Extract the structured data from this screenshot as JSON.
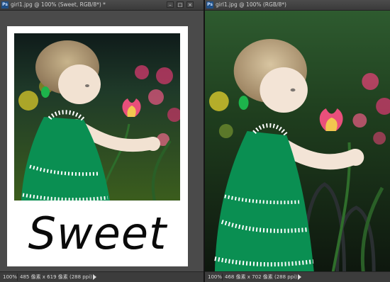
{
  "left_window": {
    "title": "girl1.jpg @ 100% (Sweet, RGB/8*) *",
    "controls": {
      "minimize": "–",
      "maximize": "□",
      "close": "×"
    },
    "status": {
      "zoom": "100%",
      "doc_info": "485 像素 x 619 像素 (288 ppi)"
    },
    "overlay_text": "Sweet"
  },
  "right_window": {
    "title": "girl1.jpg @ 100% (RGB/8*)",
    "status": {
      "zoom": "100%",
      "doc_info": "468 像素 x 702 像素 (288 ppi)"
    }
  },
  "colors": {
    "panel_bg": "#3b3b3b",
    "statusbar_bg": "#3c3c3c",
    "dress_green": "#0a8f52",
    "tulip_pink": "#e94f7b",
    "polaroid_white": "#ffffff"
  },
  "icons": {
    "app_icon": "photoshop-icon",
    "status_arrow": "arrow-right-icon"
  }
}
